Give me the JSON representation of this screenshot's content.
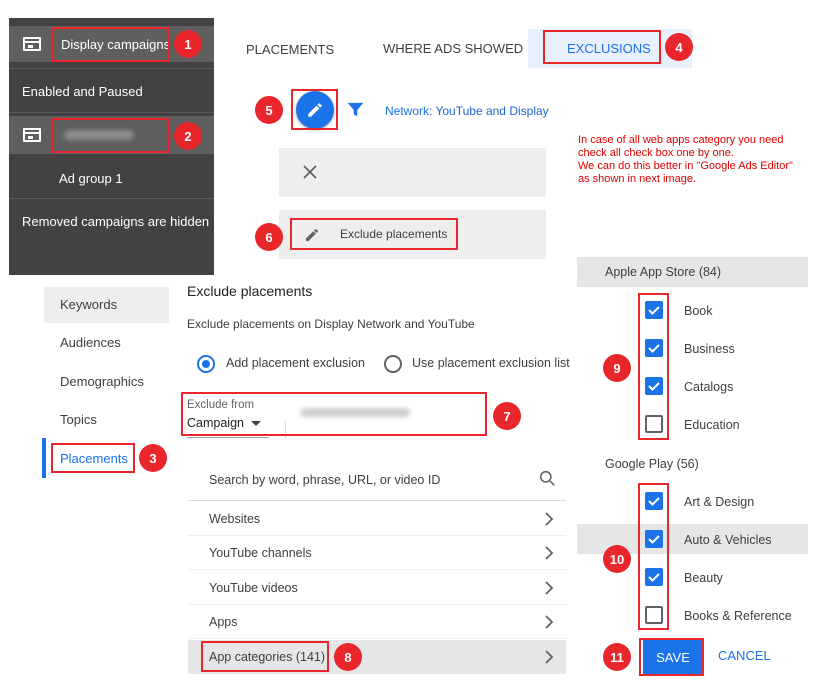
{
  "campaign_panel": {
    "display_campaigns": "Display campaigns",
    "enabled_paused": "Enabled and Paused",
    "ad_group": "Ad group 1",
    "removed_hidden": "Removed campaigns are hidden"
  },
  "nav": {
    "keywords": "Keywords",
    "audiences": "Audiences",
    "demographics": "Demographics",
    "topics": "Topics",
    "placements": "Placements"
  },
  "tabs": {
    "placements": "PLACEMENTS",
    "where_ads_showed": "WHERE ADS SHOWED",
    "exclusions": "EXCLUSIONS"
  },
  "filter": {
    "network_label": "Network:",
    "network_value": "YouTube and Display"
  },
  "exclude_button": "Exclude placements",
  "note": {
    "line1": "In case of all web apps category you need",
    "line2": "check all check box one by one.",
    "line3": "We can do this better in \"Google Ads Editor\"",
    "line4": "as shown in next image."
  },
  "panel": {
    "title": "Exclude placements",
    "subtitle": "Exclude placements on Display Network and YouTube",
    "radio_add": "Add placement exclusion",
    "radio_list": "Use placement exclusion list",
    "exclude_from_label": "Exclude from",
    "exclude_from_value": "Campaign",
    "search_placeholder": "Search by word, phrase, URL, or video ID",
    "rows": [
      "Websites",
      "YouTube channels",
      "YouTube videos",
      "Apps",
      "App categories (141)"
    ]
  },
  "app_store": {
    "header": "Apple App Store (84)",
    "items": [
      {
        "label": "Book",
        "checked": true
      },
      {
        "label": "Business",
        "checked": true
      },
      {
        "label": "Catalogs",
        "checked": true
      },
      {
        "label": "Education",
        "checked": false
      }
    ]
  },
  "google_play": {
    "header": "Google Play (56)",
    "items": [
      {
        "label": "Art & Design",
        "checked": true
      },
      {
        "label": "Auto & Vehicles",
        "checked": true
      },
      {
        "label": "Beauty",
        "checked": true
      },
      {
        "label": "Books & Reference",
        "checked": false
      }
    ]
  },
  "actions": {
    "save": "SAVE",
    "cancel": "CANCEL"
  },
  "badges": [
    "1",
    "2",
    "3",
    "4",
    "5",
    "6",
    "7",
    "8",
    "9",
    "10",
    "11"
  ],
  "colors": {
    "accent": "#1a73e8",
    "annotation": "#e8262c",
    "dark_panel": "#424242"
  }
}
